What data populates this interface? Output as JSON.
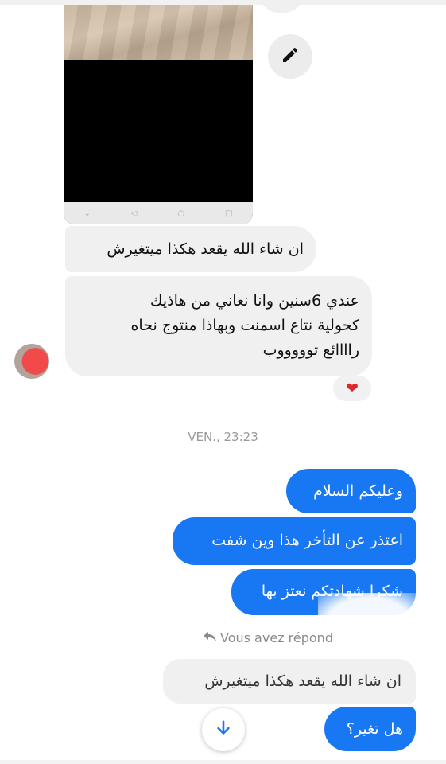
{
  "conversation": {
    "incoming": [
      {
        "text": "ان شاء الله يقعد هكذا ميتغيرش"
      },
      {
        "lines": [
          "عندي 6سنين وانا نعاني من هاذيك",
          "كحولية نتاع اسمنت وبهاذا منتوج نحاه",
          "راااائع توووووب"
        ]
      }
    ],
    "reaction": "❤",
    "timestamp": "VEN., 23:23",
    "outgoing": [
      {
        "text": "وعليكم السلام"
      },
      {
        "text": "اعتذر عن التأخر هذا وين شفت"
      },
      {
        "text": "شكرا شهادتكم نعتز بها"
      }
    ],
    "reply_indicator": {
      "icon": "reply-arrow-icon",
      "text": "Vous avez répond"
    },
    "quoted_message": "ان شاء الله يقعد هكذا ميتغيرش",
    "last_outgoing": "هل تغير؟"
  },
  "controls": {
    "edit_icon": "pencil-icon",
    "scroll_down_icon": "arrow-down-icon"
  },
  "colors": {
    "outgoing_bubble": "#1877f2",
    "incoming_bubble": "#f0f0f0",
    "reaction_heart": "#e0262a"
  }
}
